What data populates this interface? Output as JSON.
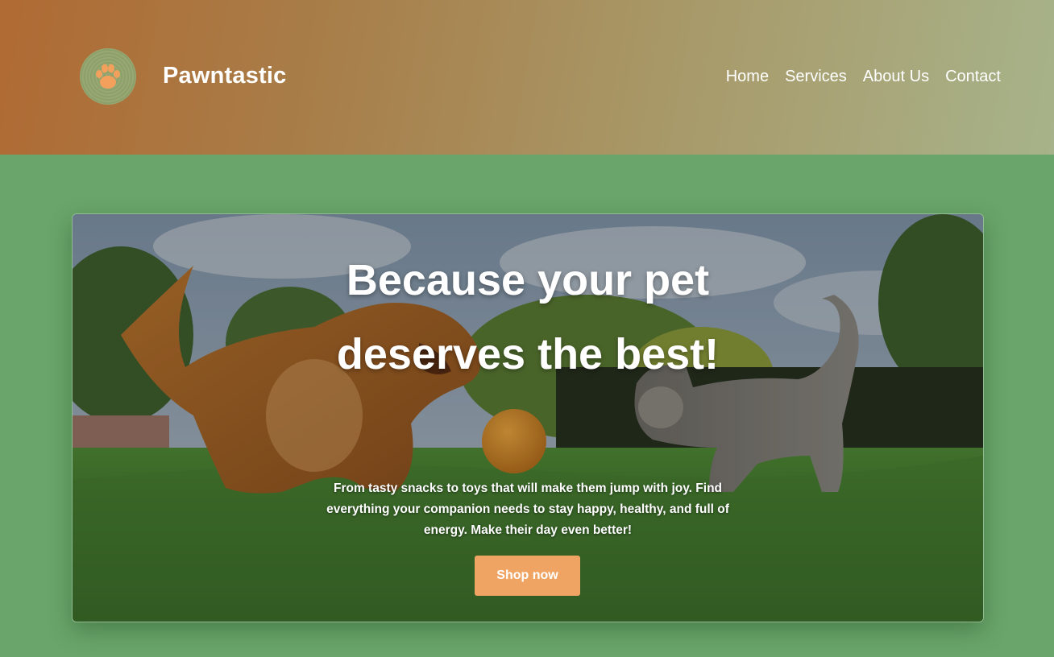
{
  "header": {
    "brand": "Pawntastic",
    "logo_icon": "paw-icon",
    "nav": [
      {
        "label": "Home"
      },
      {
        "label": "Services"
      },
      {
        "label": "About Us"
      },
      {
        "label": "Contact"
      }
    ]
  },
  "hero": {
    "headline": "Because your pet deserves the best!",
    "subtext": "From tasty snacks to toys that will make them jump with joy. Find everything your companion needs to stay happy, healthy, and full of energy. Make their day even better!",
    "cta_label": "Shop now",
    "image": "dog-and-cat-playing-with-ball-on-lawn"
  },
  "colors": {
    "page_background": "#6aa56b",
    "header_gradient_start": "#b06a33",
    "header_gradient_end": "#a7b38a",
    "cta_background": "#f0a464",
    "logo_paw": "#f2a05c"
  }
}
